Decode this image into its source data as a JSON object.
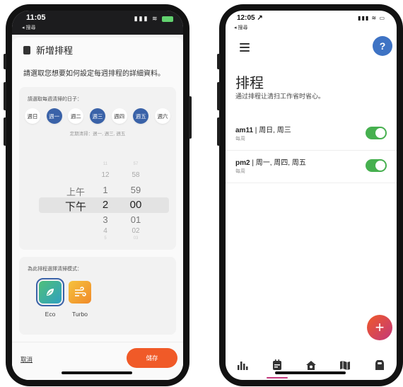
{
  "left": {
    "status": {
      "time": "11:05",
      "back": "◂ 搜尋"
    },
    "header": {
      "title": "新增排程"
    },
    "intro": "請選取您想要如何設定每週排程的詳細資料。",
    "days_card": {
      "label": "請選取每週清掃的日子：",
      "days": [
        {
          "label": "週日",
          "selected": false
        },
        {
          "label": "週一",
          "selected": true
        },
        {
          "label": "週二",
          "selected": false
        },
        {
          "label": "週三",
          "selected": true
        },
        {
          "label": "週四",
          "selected": false
        },
        {
          "label": "週五",
          "selected": true
        },
        {
          "label": "週六",
          "selected": false
        }
      ],
      "summary": "定期清掃：週一, 週三, 週五"
    },
    "time_picker": {
      "ampm": [
        "上午",
        "下午"
      ],
      "hours": [
        "11",
        "12",
        "1",
        "2",
        "3",
        "4",
        "5"
      ],
      "minutes": [
        "57",
        "58",
        "59",
        "00",
        "01",
        "02",
        "03"
      ],
      "selected": {
        "ampm": "下午",
        "hour": "2",
        "minute": "00"
      }
    },
    "mode_card": {
      "label": "為此排程選擇清掃模式：",
      "modes": [
        {
          "name": "Eco",
          "icon": "leaf-icon",
          "selected": true
        },
        {
          "name": "Turbo",
          "icon": "wind-icon",
          "selected": false
        }
      ]
    },
    "footer": {
      "cancel": "取消",
      "save": "儲存"
    },
    "colors": {
      "accent": "#f05a28",
      "selected_day": "#3a62a8"
    }
  },
  "right": {
    "status": {
      "time": "12:05 ↗",
      "back": "◂ 搜尋"
    },
    "header": {
      "help": "?"
    },
    "title": "排程",
    "subtitle": "通过排程让清扫工作省时省心。",
    "schedules": [
      {
        "name": "am11",
        "days": "周日, 周三",
        "repeat": "每周",
        "enabled": true
      },
      {
        "name": "pm2",
        "days": "周一, 周四, 周五",
        "repeat": "每周",
        "enabled": true
      }
    ],
    "fab": "+",
    "nav": [
      {
        "icon": "bar-chart-icon",
        "active": false
      },
      {
        "icon": "schedule-icon",
        "active": true
      },
      {
        "icon": "home-icon",
        "active": false
      },
      {
        "icon": "map-icon",
        "active": false
      },
      {
        "icon": "robot-icon",
        "active": false
      }
    ],
    "colors": {
      "toggle_on": "#46b04f",
      "help": "#3e73c4",
      "fab": "#f05a28"
    }
  }
}
